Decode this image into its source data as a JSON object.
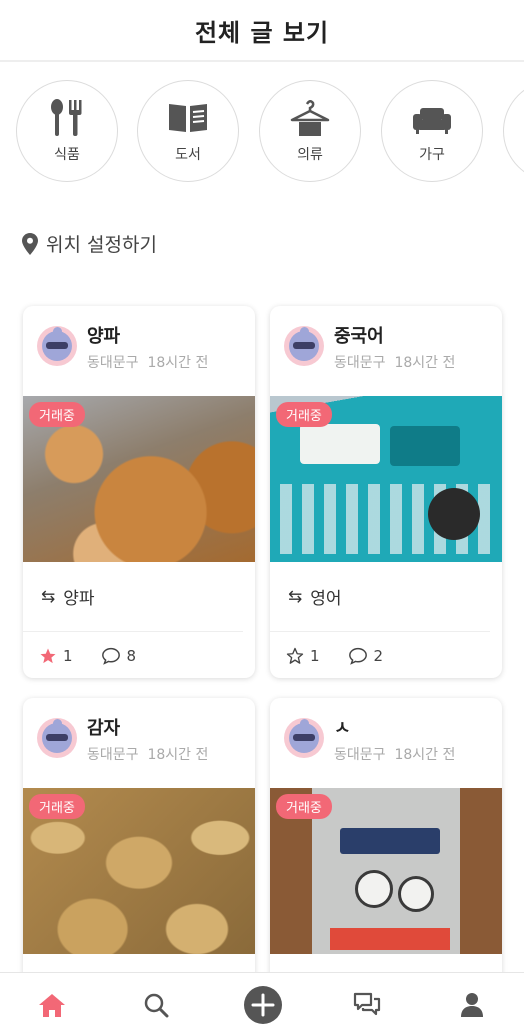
{
  "header": {
    "title": "전체 글 보기"
  },
  "categories": [
    {
      "label": "식품",
      "icon": "utensils-icon"
    },
    {
      "label": "도서",
      "icon": "book-icon"
    },
    {
      "label": "의류",
      "icon": "hanger-icon"
    },
    {
      "label": "가구",
      "icon": "sofa-icon"
    }
  ],
  "location": {
    "label": "위치 설정하기",
    "icon": "location-pin-icon"
  },
  "posts": [
    {
      "title": "양파",
      "area": "동대문구",
      "time": "18시간 전",
      "status": "거래중",
      "exchange": "양파",
      "likes": "1",
      "liked": true,
      "comments": "8"
    },
    {
      "title": "중국어",
      "area": "동대문구",
      "time": "18시간 전",
      "status": "거래중",
      "exchange": "영어",
      "likes": "1",
      "liked": false,
      "comments": "2"
    },
    {
      "title": "감자",
      "area": "동대문구",
      "time": "18시간 전",
      "status": "거래중"
    },
    {
      "title": "ㅅ",
      "area": "동대문구",
      "time": "18시간 전",
      "status": "거래중"
    }
  ],
  "nav": {
    "active": "home",
    "items": [
      "home-icon",
      "search-icon",
      "add-icon",
      "chat-icon",
      "profile-icon"
    ]
  },
  "colors": {
    "accent": "#f26876",
    "icon": "#555555"
  }
}
